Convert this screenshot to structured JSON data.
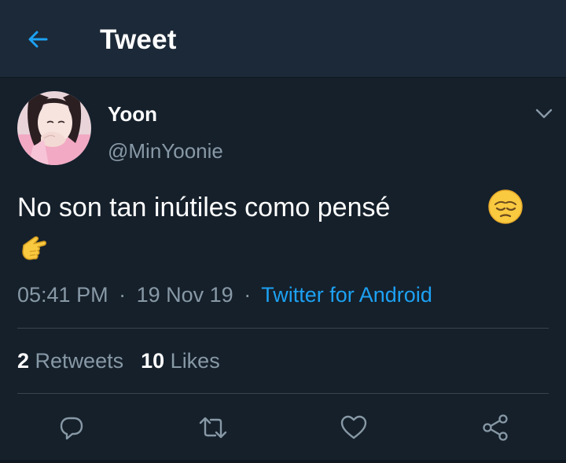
{
  "header": {
    "title": "Tweet",
    "back_icon": "arrow-left-icon",
    "accent": "#1da1f2"
  },
  "author": {
    "name": "Yoon",
    "handle": "@MinYoonie",
    "avatar": "avatar-photo",
    "menu_icon": "chevron-down-icon"
  },
  "tweet": {
    "text": "No son tan inútiles como pensé",
    "emojis": [
      "pensive-face-emoji",
      "pointing-hand-emoji"
    ],
    "time": "05:41 PM",
    "date": "19 Nov 19",
    "separator": "·",
    "source": "Twitter for Android"
  },
  "stats": {
    "retweets_count": "2",
    "retweets_label": "Retweets",
    "likes_count": "10",
    "likes_label": "Likes"
  },
  "actions": [
    "reply-icon",
    "retweet-icon",
    "like-icon",
    "share-icon"
  ],
  "colors": {
    "background": "#15202b",
    "header": "#1c2938",
    "secondary_text": "#8899a6",
    "divider": "#38444d",
    "link": "#1da1f2"
  }
}
